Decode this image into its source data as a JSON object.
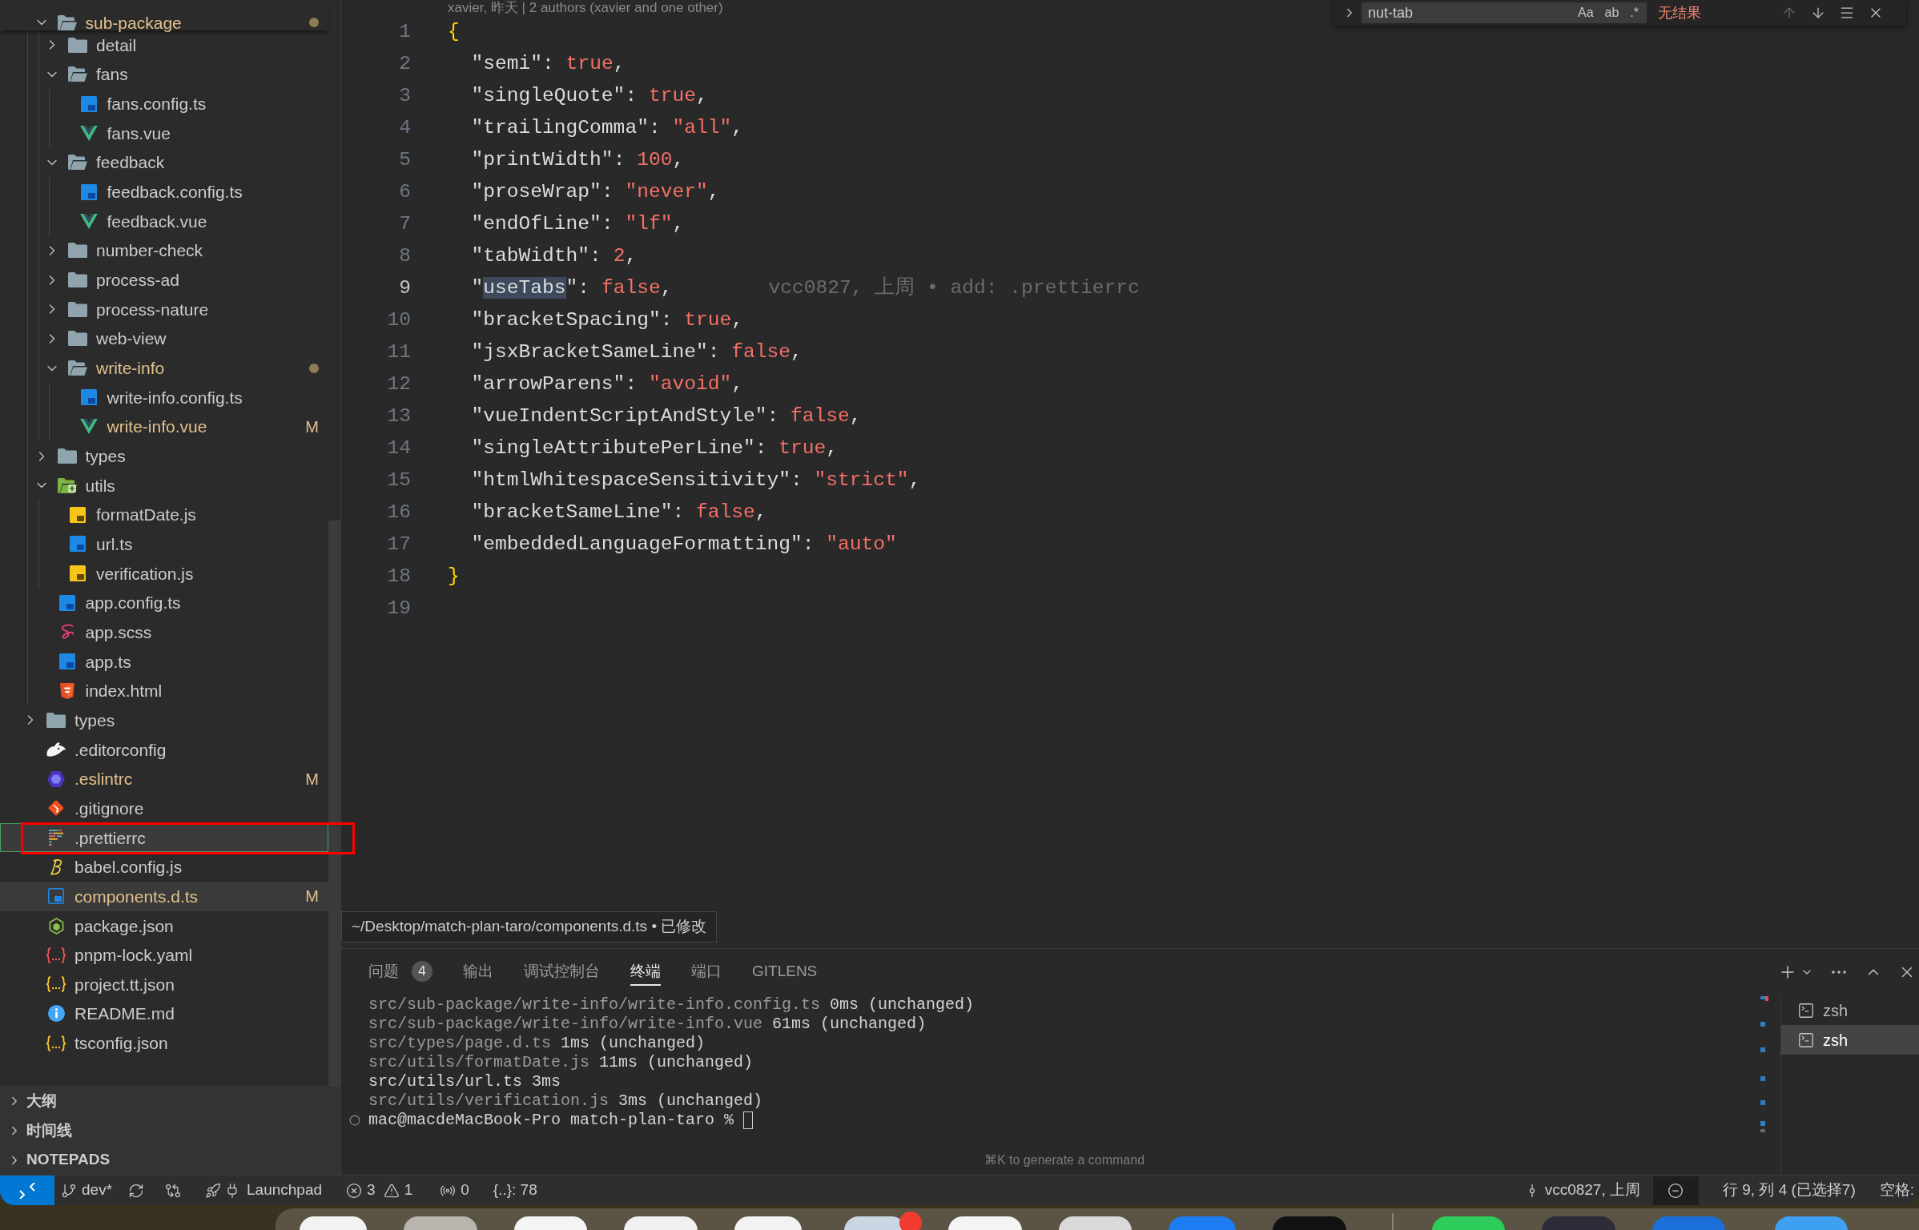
{
  "explorer": {
    "src_items": [
      {
        "name": "sub-package",
        "kind": "folder",
        "expanded": true,
        "selected": false,
        "hovered": false,
        "modified": true,
        "annotated": false,
        "children": [
          {
            "name": "detail",
            "kind": "folder",
            "expanded": false,
            "selected": false,
            "hovered": false,
            "modified": false,
            "annotated": false
          },
          {
            "name": "fans",
            "kind": "folder",
            "expanded": true,
            "selected": false,
            "hovered": false,
            "modified": false,
            "annotated": false,
            "children": [
              {
                "name": "fans.config.ts",
                "kind": "ts",
                "selected": false,
                "hovered": false,
                "modified": false,
                "annotated": false
              },
              {
                "name": "fans.vue",
                "kind": "vue",
                "selected": false,
                "hovered": false,
                "modified": false,
                "annotated": false
              }
            ]
          },
          {
            "name": "feedback",
            "kind": "folder",
            "expanded": true,
            "selected": false,
            "hovered": false,
            "modified": false,
            "annotated": false,
            "children": [
              {
                "name": "feedback.config.ts",
                "kind": "ts",
                "selected": false,
                "hovered": false,
                "modified": false,
                "annotated": false
              },
              {
                "name": "feedback.vue",
                "kind": "vue",
                "selected": false,
                "hovered": false,
                "modified": false,
                "annotated": false
              }
            ]
          },
          {
            "name": "number-check",
            "kind": "folder",
            "expanded": false,
            "selected": false,
            "hovered": false,
            "modified": false,
            "annotated": false
          },
          {
            "name": "process-ad",
            "kind": "folder",
            "expanded": false,
            "selected": false,
            "hovered": false,
            "modified": false,
            "annotated": false
          },
          {
            "name": "process-nature",
            "kind": "folder",
            "expanded": false,
            "selected": false,
            "hovered": false,
            "modified": false,
            "annotated": false
          },
          {
            "name": "web-view",
            "kind": "folder",
            "expanded": false,
            "selected": false,
            "hovered": false,
            "modified": false,
            "annotated": false
          },
          {
            "name": "write-info",
            "kind": "folder",
            "expanded": true,
            "selected": false,
            "hovered": false,
            "modified": true,
            "annotated": false,
            "children": [
              {
                "name": "write-info.config.ts",
                "kind": "ts",
                "selected": false,
                "hovered": false,
                "modified": false,
                "annotated": false
              },
              {
                "name": "write-info.vue",
                "kind": "vue",
                "selected": false,
                "hovered": false,
                "modified": true,
                "annotated": false,
                "badge": "M"
              }
            ]
          }
        ]
      },
      {
        "name": "types",
        "kind": "folder",
        "expanded": false,
        "selected": false,
        "hovered": false,
        "modified": false,
        "annotated": false
      },
      {
        "name": "utils",
        "kind": "utils-folder",
        "expanded": true,
        "selected": false,
        "hovered": false,
        "modified": false,
        "annotated": false,
        "children": [
          {
            "name": "formatDate.js",
            "kind": "js",
            "selected": false,
            "hovered": false,
            "modified": false,
            "annotated": false
          },
          {
            "name": "url.ts",
            "kind": "ts",
            "selected": false,
            "hovered": false,
            "modified": false,
            "annotated": false
          },
          {
            "name": "verification.js",
            "kind": "js",
            "selected": false,
            "hovered": false,
            "modified": false,
            "annotated": false
          }
        ]
      },
      {
        "name": "app.config.ts",
        "kind": "ts",
        "selected": false,
        "hovered": false,
        "modified": false,
        "annotated": false
      },
      {
        "name": "app.scss",
        "kind": "scss",
        "selected": false,
        "hovered": false,
        "modified": false,
        "annotated": false
      },
      {
        "name": "app.ts",
        "kind": "ts",
        "selected": false,
        "hovered": false,
        "modified": false,
        "annotated": false
      },
      {
        "name": "index.html",
        "kind": "html",
        "selected": false,
        "hovered": false,
        "modified": false,
        "annotated": false
      }
    ],
    "root_items": [
      {
        "name": "types",
        "kind": "folder",
        "expanded": false,
        "selected": false,
        "hovered": false,
        "modified": false,
        "annotated": false
      },
      {
        "name": ".editorconfig",
        "kind": "editorconfig",
        "selected": false,
        "hovered": false,
        "modified": false,
        "annotated": false
      },
      {
        "name": ".eslintrc",
        "kind": "eslint",
        "selected": false,
        "hovered": false,
        "modified": true,
        "annotated": false,
        "badge": "M"
      },
      {
        "name": ".gitignore",
        "kind": "git",
        "selected": false,
        "hovered": false,
        "modified": false,
        "annotated": false
      },
      {
        "name": ".prettierrc",
        "kind": "prettier",
        "selected": true,
        "hovered": false,
        "modified": false,
        "annotated": true
      },
      {
        "name": "babel.config.js",
        "kind": "babel",
        "selected": false,
        "hovered": false,
        "modified": false,
        "annotated": false
      },
      {
        "name": "components.d.ts",
        "kind": "ts-declaration",
        "selected": false,
        "hovered": true,
        "modified": true,
        "annotated": false,
        "badge": "M"
      },
      {
        "name": "package.json",
        "kind": "npm",
        "selected": false,
        "hovered": false,
        "modified": false,
        "annotated": false
      },
      {
        "name": "pnpm-lock.yaml",
        "kind": "lock",
        "selected": false,
        "hovered": false,
        "modified": false,
        "annotated": false
      },
      {
        "name": "project.tt.json",
        "kind": "json",
        "selected": false,
        "hovered": false,
        "modified": false,
        "annotated": false
      },
      {
        "name": "README.md",
        "kind": "readme",
        "selected": false,
        "hovered": false,
        "modified": false,
        "annotated": false
      },
      {
        "name": "tsconfig.json",
        "kind": "json",
        "selected": false,
        "hovered": false,
        "modified": false,
        "annotated": false
      }
    ],
    "sections": [
      {
        "label": "大纲",
        "expanded": false
      },
      {
        "label": "时间线",
        "expanded": false
      },
      {
        "label": "NOTEPADS",
        "expanded": false
      }
    ]
  },
  "editor": {
    "codelens": "xavier, 昨天 | 2 authors (xavier and one other)",
    "find": {
      "value": "nut-tab",
      "toggles": [
        "Aa",
        "ab",
        ".*"
      ],
      "result": "无结果"
    },
    "lines": [
      {
        "number": "1",
        "current": false,
        "tokens": [
          {
            "kind": "brace",
            "text": "{"
          }
        ]
      },
      {
        "number": "2",
        "current": false,
        "tokens": [
          {
            "kind": "key",
            "text": "  \"semi\""
          },
          {
            "kind": "punct",
            "text": ": "
          },
          {
            "kind": "value",
            "text": "true"
          },
          {
            "kind": "punct",
            "text": ","
          }
        ]
      },
      {
        "number": "3",
        "current": false,
        "tokens": [
          {
            "kind": "key",
            "text": "  \"singleQuote\""
          },
          {
            "kind": "punct",
            "text": ": "
          },
          {
            "kind": "value",
            "text": "true"
          },
          {
            "kind": "punct",
            "text": ","
          }
        ]
      },
      {
        "number": "4",
        "current": false,
        "tokens": [
          {
            "kind": "key",
            "text": "  \"trailingComma\""
          },
          {
            "kind": "punct",
            "text": ": "
          },
          {
            "kind": "value",
            "text": "\"all\""
          },
          {
            "kind": "punct",
            "text": ","
          }
        ]
      },
      {
        "number": "5",
        "current": false,
        "tokens": [
          {
            "kind": "key",
            "text": "  \"printWidth\""
          },
          {
            "kind": "punct",
            "text": ": "
          },
          {
            "kind": "value",
            "text": "100"
          },
          {
            "kind": "punct",
            "text": ","
          }
        ]
      },
      {
        "number": "6",
        "current": false,
        "tokens": [
          {
            "kind": "key",
            "text": "  \"proseWrap\""
          },
          {
            "kind": "punct",
            "text": ": "
          },
          {
            "kind": "value",
            "text": "\"never\""
          },
          {
            "kind": "punct",
            "text": ","
          }
        ]
      },
      {
        "number": "7",
        "current": false,
        "tokens": [
          {
            "kind": "key",
            "text": "  \"endOfLine\""
          },
          {
            "kind": "punct",
            "text": ": "
          },
          {
            "kind": "value",
            "text": "\"lf\""
          },
          {
            "kind": "punct",
            "text": ","
          }
        ]
      },
      {
        "number": "8",
        "current": false,
        "tokens": [
          {
            "kind": "key",
            "text": "  \"tabWidth\""
          },
          {
            "kind": "punct",
            "text": ": "
          },
          {
            "kind": "value",
            "text": "2"
          },
          {
            "kind": "punct",
            "text": ","
          }
        ]
      },
      {
        "number": "9",
        "current": true,
        "blame": "vcc0827, 上周 • add: .prettierrc",
        "tokens": [
          {
            "kind": "key",
            "text": "  \""
          },
          {
            "kind": "match",
            "text": "useTabs"
          },
          {
            "kind": "key",
            "text": "\""
          },
          {
            "kind": "punct",
            "text": ": "
          },
          {
            "kind": "value",
            "text": "false"
          },
          {
            "kind": "punct",
            "text": ","
          }
        ]
      },
      {
        "number": "10",
        "current": false,
        "tokens": [
          {
            "kind": "key",
            "text": "  \"bracketSpacing\""
          },
          {
            "kind": "punct",
            "text": ": "
          },
          {
            "kind": "value",
            "text": "true"
          },
          {
            "kind": "punct",
            "text": ","
          }
        ]
      },
      {
        "number": "11",
        "current": false,
        "tokens": [
          {
            "kind": "key",
            "text": "  \"jsxBracketSameLine\""
          },
          {
            "kind": "punct",
            "text": ": "
          },
          {
            "kind": "value",
            "text": "false"
          },
          {
            "kind": "punct",
            "text": ","
          }
        ]
      },
      {
        "number": "12",
        "current": false,
        "tokens": [
          {
            "kind": "key",
            "text": "  \"arrowParens\""
          },
          {
            "kind": "punct",
            "text": ": "
          },
          {
            "kind": "value",
            "text": "\"avoid\""
          },
          {
            "kind": "punct",
            "text": ","
          }
        ]
      },
      {
        "number": "13",
        "current": false,
        "tokens": [
          {
            "kind": "key",
            "text": "  \"vueIndentScriptAndStyle\""
          },
          {
            "kind": "punct",
            "text": ": "
          },
          {
            "kind": "value",
            "text": "false"
          },
          {
            "kind": "punct",
            "text": ","
          }
        ]
      },
      {
        "number": "14",
        "current": false,
        "tokens": [
          {
            "kind": "key",
            "text": "  \"singleAttributePerLine\""
          },
          {
            "kind": "punct",
            "text": ": "
          },
          {
            "kind": "value",
            "text": "true"
          },
          {
            "kind": "punct",
            "text": ","
          }
        ]
      },
      {
        "number": "15",
        "current": false,
        "tokens": [
          {
            "kind": "key",
            "text": "  \"htmlWhitespaceSensitivity\""
          },
          {
            "kind": "punct",
            "text": ": "
          },
          {
            "kind": "value",
            "text": "\"strict\""
          },
          {
            "kind": "punct",
            "text": ","
          }
        ]
      },
      {
        "number": "16",
        "current": false,
        "tokens": [
          {
            "kind": "key",
            "text": "  \"bracketSameLine\""
          },
          {
            "kind": "punct",
            "text": ": "
          },
          {
            "kind": "value",
            "text": "false"
          },
          {
            "kind": "punct",
            "text": ","
          }
        ]
      },
      {
        "number": "17",
        "current": false,
        "tokens": [
          {
            "kind": "key",
            "text": "  \"embeddedLanguageFormatting\""
          },
          {
            "kind": "punct",
            "text": ": "
          },
          {
            "kind": "value",
            "text": "\"auto\""
          }
        ]
      },
      {
        "number": "18",
        "current": false,
        "tokens": [
          {
            "kind": "brace",
            "text": "}"
          }
        ]
      },
      {
        "number": "19",
        "current": false
      }
    ],
    "tooltip": "~/Desktop/match-plan-taro/components.d.ts • 已修改"
  },
  "panel": {
    "tabs": [
      {
        "label": "问题",
        "count": "4",
        "selected": false
      },
      {
        "label": "输出",
        "selected": false
      },
      {
        "label": "调试控制台",
        "selected": false
      },
      {
        "label": "终端",
        "selected": true
      },
      {
        "label": "端口",
        "selected": false
      },
      {
        "label": "GITLENS",
        "selected": false
      }
    ],
    "terminal_lines": [
      [
        {
          "kind": "dim",
          "text": "src/sub-package/write-info/write-info.config.ts"
        },
        {
          "kind": "plain",
          "text": " 0ms (unchanged)"
        }
      ],
      [
        {
          "kind": "dim",
          "text": "src/sub-package/write-info/write-info.vue"
        },
        {
          "kind": "plain",
          "text": " 61ms (unchanged)"
        }
      ],
      [
        {
          "kind": "dim",
          "text": "src/types/page.d.ts"
        },
        {
          "kind": "plain",
          "text": " 1ms (unchanged)"
        }
      ],
      [
        {
          "kind": "dim",
          "text": "src/utils/formatDate.js"
        },
        {
          "kind": "plain",
          "text": " 11ms (unchanged)"
        }
      ],
      [
        {
          "kind": "plain",
          "text": "src/utils/url.ts 3ms"
        }
      ],
      [
        {
          "kind": "dim",
          "text": "src/utils/verification.js"
        },
        {
          "kind": "plain",
          "text": " 3ms (unchanged)"
        }
      ]
    ],
    "prompt": "mac@macdeMacBook-Pro match-plan-taro %",
    "hint": "⌘K to generate a command",
    "terminals": [
      {
        "label": "zsh",
        "selected": false
      },
      {
        "label": "zsh",
        "selected": true
      }
    ]
  },
  "status_bar": {
    "left": [
      {
        "kind": "remote"
      },
      {
        "kind": "branch",
        "text": "dev*"
      },
      {
        "kind": "sync"
      },
      {
        "kind": "compare"
      },
      {
        "kind": "launchpad",
        "text": "Launchpad"
      },
      {
        "kind": "problems",
        "errors": "3",
        "warnings": "1"
      },
      {
        "kind": "ports",
        "text": "0"
      },
      {
        "kind": "plain",
        "text": "{..}: 78"
      }
    ],
    "right": [
      {
        "kind": "blame",
        "text": "vcc0827, 上周"
      },
      {
        "kind": "circle"
      },
      {
        "kind": "plain",
        "text": "行 9, 列 4 (已选择7)"
      },
      {
        "kind": "plain",
        "text": "空格:"
      }
    ]
  }
}
